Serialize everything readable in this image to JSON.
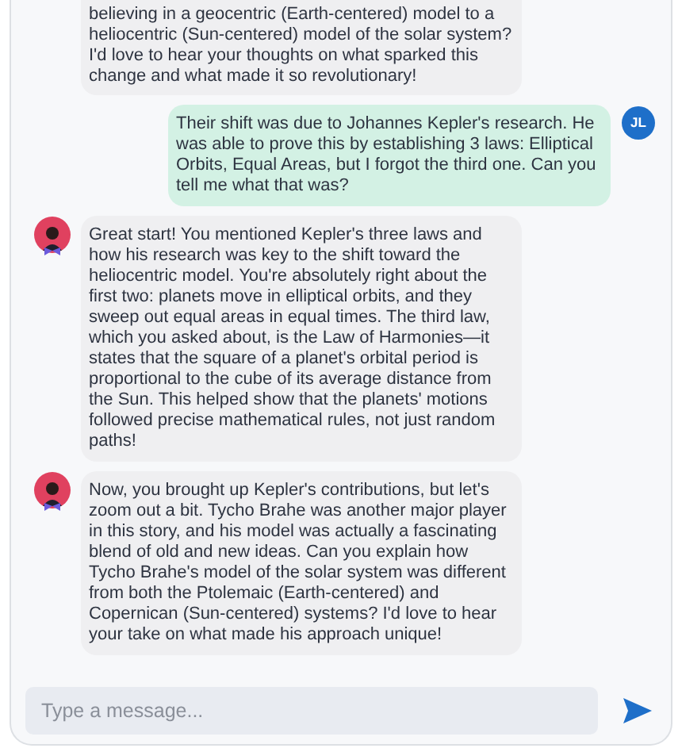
{
  "messages": [
    {
      "kind": "assistant_continued",
      "text": "believing in a geocentric (Earth-centered) model to a heliocentric (Sun-centered) model of the solar system? I'd love to hear your thoughts on what sparked this change and what made it so revolutionary!"
    },
    {
      "kind": "user",
      "initials": "JL",
      "text": "Their shift was due to Johannes Kepler's research. He was able to prove this by establishing 3 laws: Elliptical Orbits, Equal Areas, but I forgot the third one. Can you tell me what that was?"
    },
    {
      "kind": "assistant",
      "text": "Great start! You mentioned Kepler's three laws and how his research was key to the shift toward the heliocentric model. You're absolutely right about the first two: planets move in elliptical orbits, and they sweep out equal areas in equal times. The third law, which you asked about, is the Law of Harmonies—it states that the square of a planet's orbital period is proportional to the cube of its average distance from the Sun. This helped show that the planets' motions followed precise mathematical rules, not just random paths!"
    },
    {
      "kind": "assistant",
      "text": "Now, you brought up Kepler's contributions, but let's zoom out a bit. Tycho Brahe was another major player in this story, and his model was actually a fascinating blend of old and new ideas. Can you explain how Tycho Brahe's model of the solar system was different from both the Ptolemaic (Earth-centered) and Copernican (Sun-centered) systems? I'd love to hear your take on what made his approach unique!"
    }
  ],
  "composer": {
    "placeholder": "Type a message..."
  }
}
